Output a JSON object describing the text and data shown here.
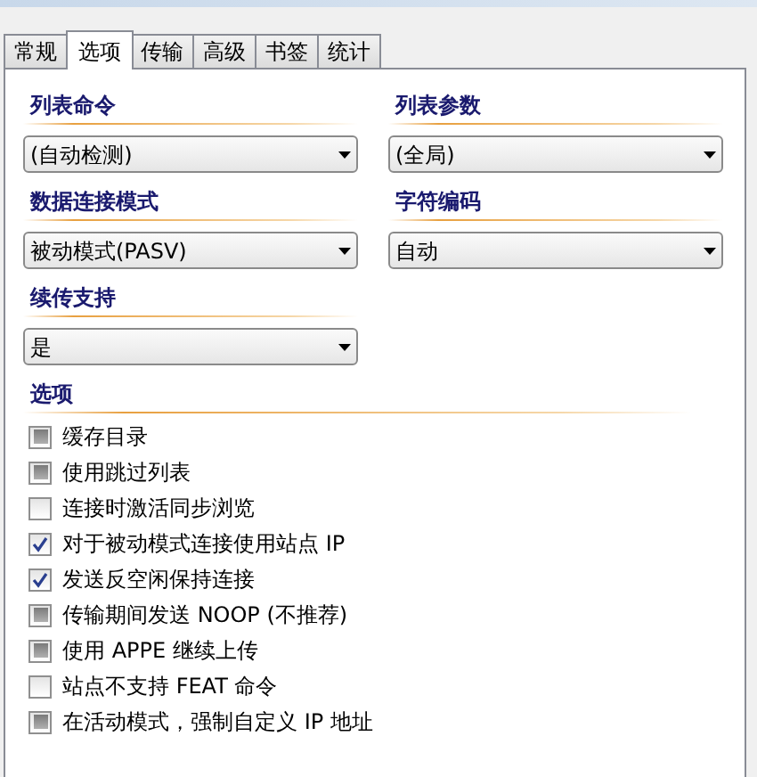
{
  "tabs": [
    {
      "label": "常规",
      "selected": false
    },
    {
      "label": "选项",
      "selected": true
    },
    {
      "label": "传输",
      "selected": false
    },
    {
      "label": "高级",
      "selected": false
    },
    {
      "label": "书签",
      "selected": false
    },
    {
      "label": "统计",
      "selected": false
    }
  ],
  "fields": [
    {
      "label": "列表命令",
      "value": "(自动检测)"
    },
    {
      "label": "列表参数",
      "value": "(全局)"
    },
    {
      "label": "数据连接模式",
      "value": "被动模式(PASV)"
    },
    {
      "label": "字符编码",
      "value": "自动"
    },
    {
      "label": "续传支持",
      "value": "是"
    }
  ],
  "options": {
    "heading": "选项",
    "items": [
      {
        "label": "缓存目录",
        "kind": "indeterminate"
      },
      {
        "label": "使用跳过列表",
        "kind": "indeterminate"
      },
      {
        "label": "连接时激活同步浏览",
        "kind": "unchecked"
      },
      {
        "label": "对于被动模式连接使用站点 IP",
        "kind": "checked"
      },
      {
        "label": "发送反空闲保持连接",
        "kind": "checked"
      },
      {
        "label": "传输期间发送 NOOP (不推荐)",
        "kind": "indeterminate"
      },
      {
        "label": "使用 APPE 继续上传",
        "kind": "indeterminate"
      },
      {
        "label": "站点不支持 FEAT 命令",
        "kind": "unchecked"
      },
      {
        "label": "在活动模式，强制自定义 IP 地址",
        "kind": "indeterminate"
      }
    ]
  }
}
